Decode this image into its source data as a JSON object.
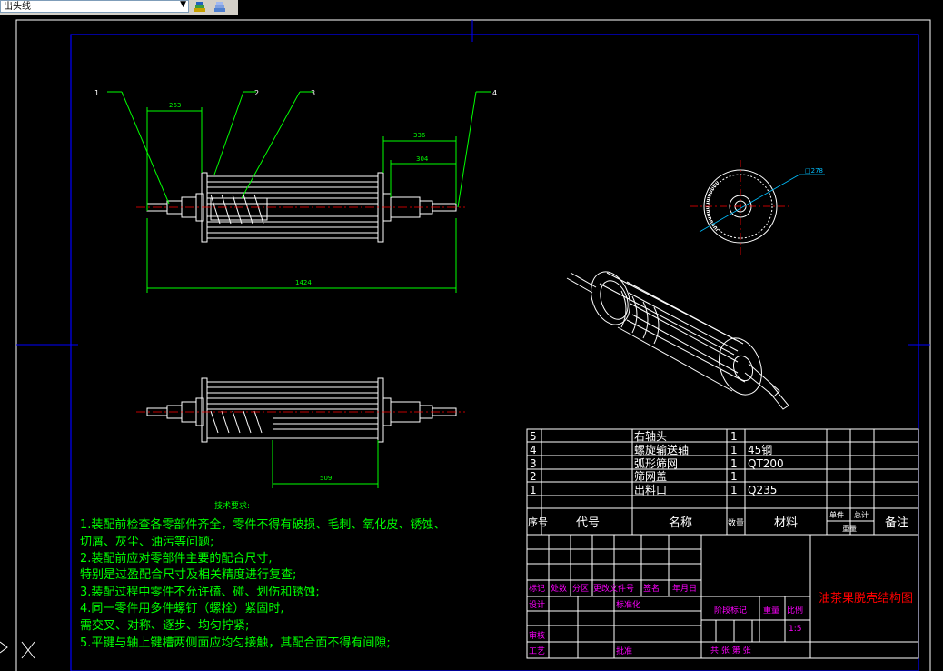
{
  "toolbar": {
    "layer_value": "出头线",
    "dropdown_arrow": "▼",
    "icons": [
      "layer-states-icon",
      "layer-manager-icon"
    ]
  },
  "part_callouts": [
    "1",
    "2",
    "3",
    "4"
  ],
  "dimensions": {
    "d263": "263",
    "d336": "336",
    "d304": "304",
    "d1424": "1424",
    "d509": "509",
    "d278": "□278"
  },
  "tech_requirements": {
    "title": "技术要求:",
    "lines": [
      "1.装配前检查各零部件齐全，零件不得有破损、毛刺、氧化皮、锈蚀、",
      "切屑、灰尘、油污等问题;",
      "2.装配前应对零部件主要的配合尺寸,",
      "特别是过盈配合尺寸及相关精度进行复查;",
      "3.装配过程中零件不允许磕、碰、划伤和锈蚀;",
      "4.同一零件用多件螺钉（螺栓）紧固时,",
      "需交叉、对称、逐步、均匀拧紧;",
      "5.平键与轴上键槽两侧面应均匀接触，其配合面不得有间隙;"
    ]
  },
  "bom": {
    "rows": [
      {
        "no": "5",
        "code": "",
        "name": "右轴头",
        "qty": "1",
        "material": ""
      },
      {
        "no": "4",
        "code": "",
        "name": "螺旋输送轴",
        "qty": "1",
        "material": "45钢"
      },
      {
        "no": "3",
        "code": "",
        "name": "弧形筛网",
        "qty": "1",
        "material": "QT200"
      },
      {
        "no": "2",
        "code": "",
        "name": "筛网盖",
        "qty": "1",
        "material": ""
      },
      {
        "no": "1",
        "code": "",
        "name": "出料口",
        "qty": "1",
        "material": "Q235"
      }
    ],
    "headers": {
      "no": "序号",
      "code": "代号",
      "name": "名称",
      "qty": "数量",
      "material": "材料",
      "unit": "单件",
      "total": "总计",
      "weight": "重量",
      "remark": "备注"
    }
  },
  "title_block": {
    "mark": "标记",
    "count": "处数",
    "zone": "分区",
    "doc_no": "更改文件号",
    "sign": "签名",
    "date": "年月日",
    "design": "设计",
    "standard": "标准化",
    "review": "审核",
    "process": "工艺",
    "approve": "批准",
    "stage_mark": "阶段标记",
    "weight": "重量",
    "scale": "比例",
    "scale_value": "1:5",
    "sheets": "共  张 第  张",
    "drawing_title": "油茶果脱壳结构图"
  },
  "colors": {
    "line": "#ffffff",
    "dimension": "#00ff00",
    "border": "#0000ff",
    "center": "#ff0000",
    "callout_blue": "#00bfff",
    "title_text": "#ff0000",
    "bom_text": "#ffffff",
    "header_text": "#ff00ff"
  }
}
